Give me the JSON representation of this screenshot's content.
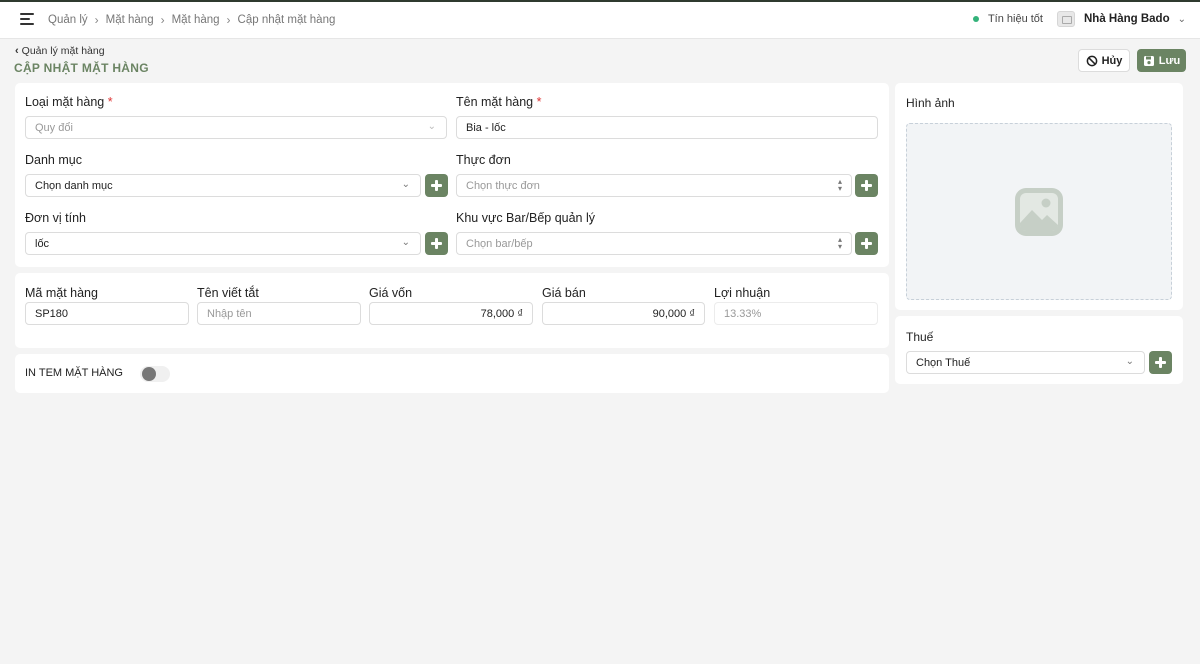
{
  "header": {
    "breadcrumb": [
      "Quản lý",
      "Mặt hàng",
      "Mặt hàng",
      "Cập nhật mặt hàng"
    ],
    "signal_label": "Tín hiệu tốt",
    "store_name": "Nhà Hàng Bado",
    "signal_color": "#33b27a"
  },
  "page": {
    "back_label": "Quản lý mặt hàng",
    "title": "CẬP NHẬT MẶT HÀNG",
    "cancel_label": "Hủy",
    "save_label": "Lưu",
    "accent_color": "#6b8463"
  },
  "form": {
    "item_type": {
      "label": "Loại mặt hàng",
      "required": "*",
      "value": "Quy đổi"
    },
    "item_name": {
      "label": "Tên mặt hàng",
      "required": "*",
      "value": "Bia - lốc"
    },
    "category": {
      "label": "Danh mục",
      "value": "Chọn danh mục"
    },
    "menu": {
      "label": "Thực đơn",
      "placeholder": "Chọn thực đơn"
    },
    "unit": {
      "label": "Đơn vị tính",
      "value": "lốc"
    },
    "kitchen_area": {
      "label": "Khu vực Bar/Bếp quản lý",
      "placeholder": "Chọn bar/bếp"
    },
    "item_code": {
      "label": "Mã mặt hàng",
      "value": "SP180"
    },
    "short_name": {
      "label": "Tên viết tắt",
      "placeholder": "Nhập tên"
    },
    "cost_price": {
      "label": "Giá vốn",
      "value": "78,000 ₫"
    },
    "sale_price": {
      "label": "Giá bán",
      "value": "90,000 ₫"
    },
    "profit": {
      "label": "Lợi nhuận",
      "value": "13.33%"
    },
    "print_label": {
      "label": "IN TEM MẶT HÀNG",
      "enabled": false
    }
  },
  "side": {
    "image_label": "Hình ảnh",
    "tax": {
      "label": "Thuế",
      "value": "Chọn Thuế"
    }
  }
}
